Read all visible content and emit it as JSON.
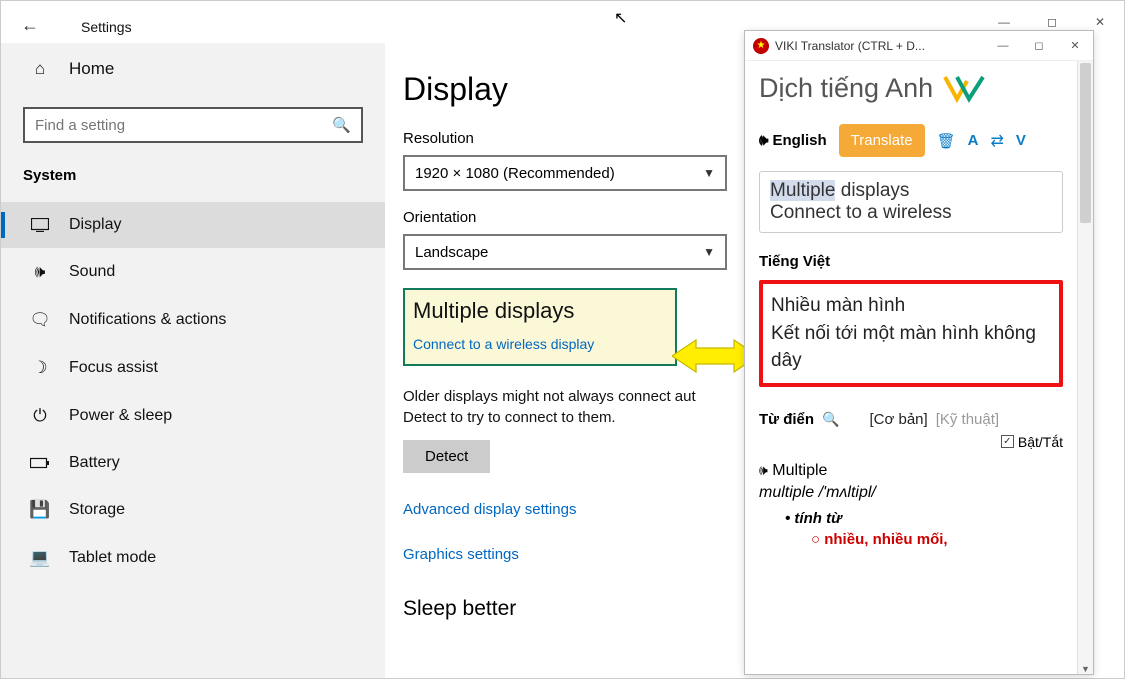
{
  "settings": {
    "title": "Settings",
    "home": "Home",
    "search_placeholder": "Find a setting",
    "section": "System",
    "nav": [
      {
        "icon": "⬜",
        "label": "Display"
      },
      {
        "icon": "🔊",
        "label": "Sound"
      },
      {
        "icon": "💬",
        "label": "Notifications & actions"
      },
      {
        "icon": "🌙",
        "label": "Focus assist"
      },
      {
        "icon": "⏻",
        "label": "Power & sleep"
      },
      {
        "icon": "🔋",
        "label": "Battery"
      },
      {
        "icon": "🗄",
        "label": "Storage"
      },
      {
        "icon": "📱",
        "label": "Tablet mode"
      }
    ]
  },
  "display": {
    "heading": "Display",
    "resolution_label": "Resolution",
    "resolution_value": "1920 × 1080 (Recommended)",
    "orientation_label": "Orientation",
    "orientation_value": "Landscape",
    "multi_heading": "Multiple displays",
    "multi_link": "Connect to a wireless display",
    "help_text": "Older displays might not always connect aut Detect to try to connect to them.",
    "detect": "Detect",
    "adv_link": "Advanced display settings",
    "gfx_link": "Graphics settings",
    "sleep_better": "Sleep better"
  },
  "viki": {
    "title": "VIKI Translator (CTRL + D...",
    "brand": "Dịch tiếng Anh",
    "lang": "English",
    "translate": "Translate",
    "letter_a": "A",
    "letter_v": "V",
    "src_word1": "Multiple",
    "src_rest1": " displays",
    "src_line2": "Connect to a wireless",
    "tgt_label": "Tiếng Việt",
    "tgt_line1": "Nhiều màn hình",
    "tgt_line2": "Kết nối tới một màn hình không dây",
    "dict_label": "Từ điển",
    "tab_basic": "Cơ bản",
    "tab_tech": "Kỹ thuật",
    "toggle": "Bật/Tắt",
    "entry_word": "Multiple",
    "entry_ipa": "multiple /'mʌltipl/",
    "entry_pos": "tính từ",
    "entry_def": "nhiều, nhiều mối,"
  }
}
